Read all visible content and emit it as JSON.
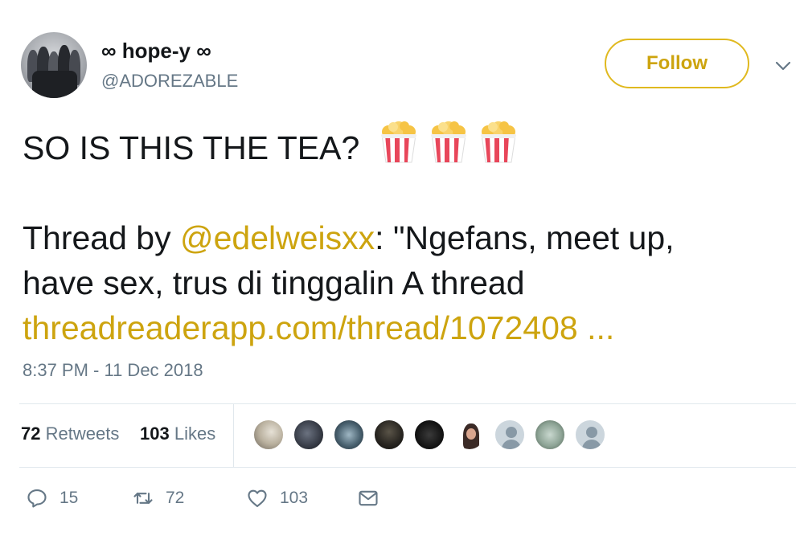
{
  "user": {
    "display_name": "∞ hope-y ∞",
    "handle": "@ADOREZABLE",
    "follow_label": "Follow"
  },
  "tweet": {
    "line1_text": "SO IS THIS THE TEA?",
    "line2_prefix": "Thread by ",
    "mention": "@edelweisxx",
    "line2_suffix": ": \"Ngefans, meet up,",
    "line3_text": "have sex, trus di tinggalin A thread",
    "link_text": "threadreaderapp.com/thread/1072408 ...",
    "emoji": [
      "popcorn",
      "popcorn",
      "popcorn"
    ]
  },
  "timestamp": "8:37 PM - 11 Dec 2018",
  "stats": {
    "retweets_count": "72",
    "retweets_label": "Retweets",
    "likes_count": "103",
    "likes_label": "Likes"
  },
  "actions": {
    "replies": "15",
    "retweets": "72",
    "likes": "103"
  },
  "colors": {
    "accent": "#cda40f",
    "text": "#14171a",
    "muted": "#657786",
    "divider": "#e1e8ed"
  },
  "icons": [
    "chevron-down-icon",
    "popcorn-icon",
    "reply-icon",
    "retweet-icon",
    "heart-icon",
    "message-icon"
  ]
}
